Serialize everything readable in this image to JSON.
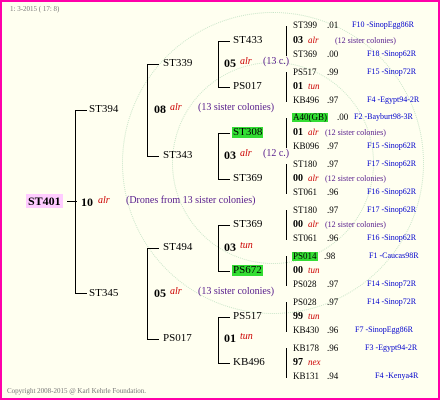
{
  "header": "1:  3-2015 ( 17:  8)",
  "footer": "Copyright 2008-2015 @ Karl Kehrle Foundation.",
  "root": {
    "name": "ST401",
    "year": "10",
    "strain": "alr",
    "note": "(Drones from 13 sister colonies)"
  },
  "gen1": [
    {
      "name": "ST394",
      "year": "08",
      "strain": "alr",
      "note": "(13 sister colonies)"
    },
    {
      "name": "ST345",
      "year": "05",
      "strain": "alr",
      "note": "(13 sister colonies)"
    }
  ],
  "gen2": [
    {
      "name": "ST339",
      "year": "05",
      "strain": "alr",
      "note": "(13 c.)"
    },
    {
      "name": "ST343",
      "year": "03",
      "strain": "alr",
      "note": "(12 c.)"
    },
    {
      "name": "ST494",
      "year": "03",
      "strain": "tun"
    },
    {
      "name": "PS017",
      "year": "01",
      "strain": "tun"
    }
  ],
  "gen3": [
    {
      "name": "ST433"
    },
    {
      "name": "PS017"
    },
    {
      "name": "ST308"
    },
    {
      "name": "ST369"
    },
    {
      "name": "ST369"
    },
    {
      "name": "PS672"
    },
    {
      "name": "PS517"
    },
    {
      "name": "KB496"
    }
  ],
  "gen4": [
    {
      "name": "ST399",
      "yr": ".01",
      "code": "F10 -SinopEgg86R"
    },
    {
      "name": "03",
      "strain": "alr",
      "note": "(12 sister colonies)"
    },
    {
      "name": "ST369",
      "yr": ".00",
      "code": "F18 -Sinop62R"
    },
    {
      "name": "PS517",
      "yr": ".99",
      "code": "F15 -Sinop72R"
    },
    {
      "name": "01",
      "strain": "tun"
    },
    {
      "name": "KB496",
      "yr": ".97",
      "code": "F4 -Egypt94-2R"
    },
    {
      "name": "A40(GB)",
      "yr": ".00",
      "code": "F2 -Bayburt98-3R"
    },
    {
      "name": "01",
      "strain": "alr",
      "note": "(12 sister colonies)"
    },
    {
      "name": "KB096",
      "yr": ".97",
      "code": "F15 -Sinop62R"
    },
    {
      "name": "ST180",
      "yr": ".97",
      "code": "F17 -Sinop62R"
    },
    {
      "name": "00",
      "strain": "alr",
      "note": "(12 sister colonies)"
    },
    {
      "name": "ST061",
      "yr": ".96",
      "code": "F16 -Sinop62R"
    },
    {
      "name": "ST180",
      "yr": ".97",
      "code": "F17 -Sinop62R"
    },
    {
      "name": "00",
      "strain": "alr",
      "note": "(12 sister colonies)"
    },
    {
      "name": "ST061",
      "yr": ".96",
      "code": "F16 -Sinop62R"
    },
    {
      "name": "PS014",
      "yr": ".98",
      "code": "F1 -Caucas98R"
    },
    {
      "name": "00",
      "strain": "tun"
    },
    {
      "name": "PS028",
      "yr": ".97",
      "code": "F14 -Sinop72R"
    },
    {
      "name": "PS028",
      "yr": ".97",
      "code": "F14 -Sinop72R"
    },
    {
      "name": "99",
      "strain": "tun"
    },
    {
      "name": "KB430",
      "yr": ".96",
      "code": "F7 -SinopEgg86R"
    },
    {
      "name": "KB178",
      "yr": ".96",
      "code": "F3 -Egypt94-2R"
    },
    {
      "name": "97",
      "strain": "nex"
    },
    {
      "name": "KB131",
      "yr": ".94",
      "code": "F4 -Kenya4R"
    }
  ],
  "colors": {
    "border": "#ff00aa",
    "highlight": "#33dd33",
    "root_bg": "#ffccff",
    "strain": "#cc0000",
    "note": "#551a8b",
    "code": "#0000cc"
  }
}
